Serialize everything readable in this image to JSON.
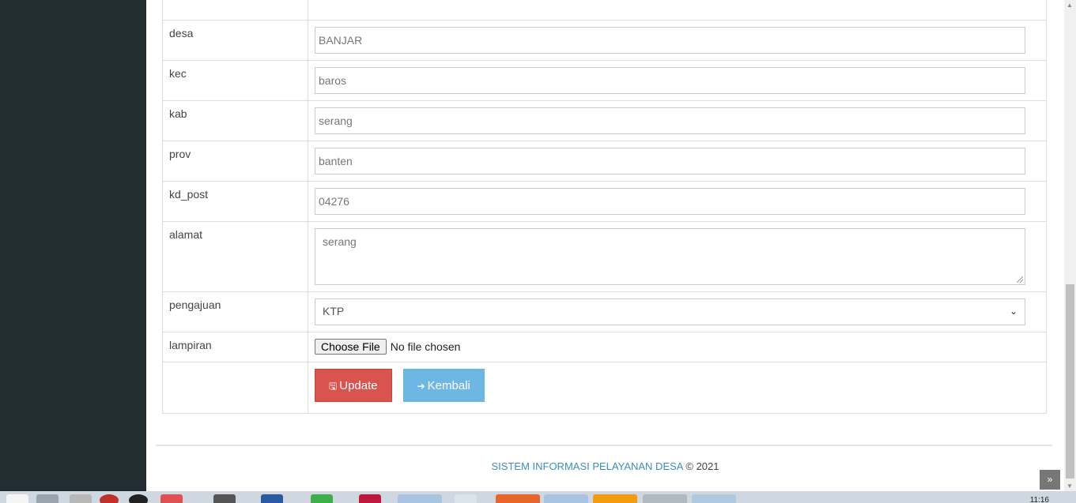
{
  "form": {
    "desa": {
      "label": "desa",
      "value": "BANJAR"
    },
    "kec": {
      "label": "kec",
      "value": "baros"
    },
    "kab": {
      "label": "kab",
      "value": "serang"
    },
    "prov": {
      "label": "prov",
      "value": "banten"
    },
    "kd_post": {
      "label": "kd_post",
      "value": "04276"
    },
    "alamat": {
      "label": "alamat",
      "value": "serang"
    },
    "pengajuan": {
      "label": "pengajuan",
      "selected": "KTP"
    },
    "lampiran": {
      "label": "lampiran",
      "button": "Choose File",
      "status": "No file chosen"
    }
  },
  "buttons": {
    "update": "Update",
    "kembali": "Kembali"
  },
  "footer": {
    "brand": "SISTEM INFORMASI PELAYANAN DESA",
    "copyright": "© 2021"
  },
  "taskbar": {
    "clock": "11:16"
  },
  "icons": {
    "update": "save-icon",
    "kembali": "sign-out-icon",
    "back_top": "double-chevron-up-icon",
    "select": "chevron-down-icon"
  }
}
